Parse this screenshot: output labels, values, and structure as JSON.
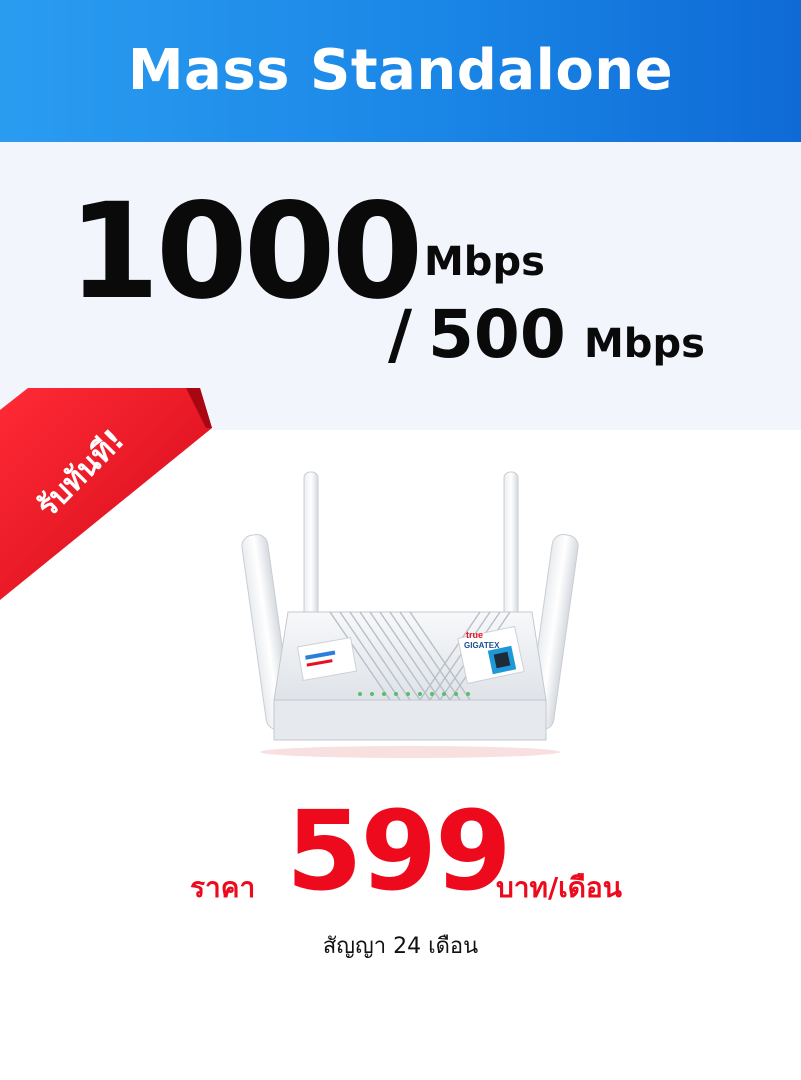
{
  "header": {
    "title": "Mass Standalone"
  },
  "speed": {
    "download_value": "1000",
    "download_unit": "Mbps",
    "separator": "/",
    "upload_value": "500",
    "upload_unit": "Mbps"
  },
  "ribbon": {
    "label": "รับทันที!"
  },
  "product": {
    "icon": "router-image",
    "brand": "true GIGATEX"
  },
  "price": {
    "label": "ราคา",
    "value": "599",
    "unit": "บาท/เดือน"
  },
  "contract": {
    "text": "สัญญา 24 เดือน"
  },
  "colors": {
    "header_start": "#2a9cf0",
    "header_end": "#0f6ad6",
    "price_red": "#ee0a1d",
    "ribbon_red": "#e8101f",
    "panel_bg": "#f2f6fc"
  }
}
